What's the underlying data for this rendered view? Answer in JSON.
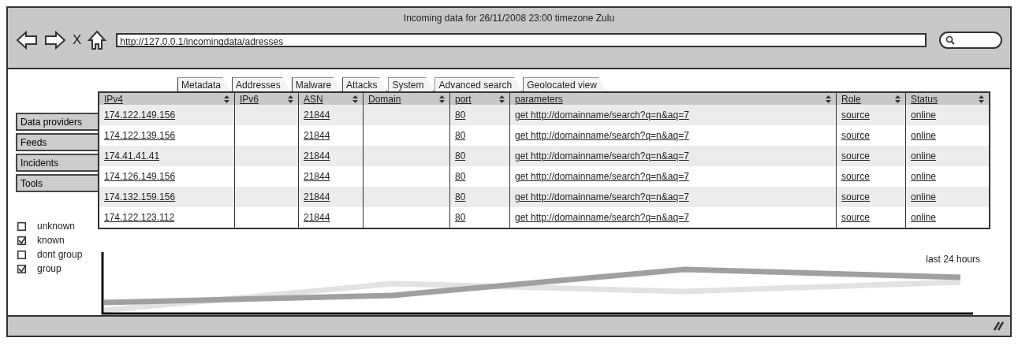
{
  "window": {
    "title": "Incoming data for 26/11/2008 23:00 timezone Zulu"
  },
  "toolbar": {
    "close": "X",
    "address": "http://127.0.0.1/incomingdata/adresses"
  },
  "tabs": [
    {
      "label": "Metadata"
    },
    {
      "label": "Addresses"
    },
    {
      "label": "Malware"
    },
    {
      "label": "Attacks"
    },
    {
      "label": "System"
    },
    {
      "label": "Advanced search"
    },
    {
      "label": "Geolocated view"
    }
  ],
  "sidebar": {
    "items": [
      "Data providers",
      "Feeds",
      "Incidents",
      "Tools"
    ]
  },
  "filters": [
    {
      "label": "unknown",
      "checked": false
    },
    {
      "label": "known",
      "checked": true
    },
    {
      "label": "dont group",
      "checked": false
    },
    {
      "label": "group",
      "checked": true
    }
  ],
  "table": {
    "columns": [
      "IPv4",
      "IPv6",
      "ASN",
      "Domain",
      "port",
      "parameters",
      "Role",
      "Status"
    ],
    "rows": [
      [
        "174.122.149.156",
        "",
        "21844",
        "",
        "80",
        "get http://domainname/search?q=n&aq=7",
        "source",
        "online"
      ],
      [
        "174.122.139.156",
        "",
        "21844",
        "",
        "80",
        "get http://domainname/search?q=n&aq=7",
        "source",
        "online"
      ],
      [
        "174.41.41.41",
        "",
        "21844",
        "",
        "80",
        "get http://domainname/search?q=n&aq=7",
        "source",
        "online"
      ],
      [
        "174.126.149.156",
        "",
        "21844",
        "",
        "80",
        "get http://domainname/search?q=n&aq=7",
        "source",
        "online"
      ],
      [
        "174.132.159.156",
        "",
        "21844",
        "",
        "80",
        "get http://domainname/search?q=n&aq=7",
        "source",
        "online"
      ],
      [
        "174.122.123.112",
        "",
        "21844",
        "",
        "80",
        "get http://domainname/search?q=n&aq=7",
        "source",
        "online"
      ]
    ]
  },
  "chart": {
    "label": "last 24 hours"
  }
}
